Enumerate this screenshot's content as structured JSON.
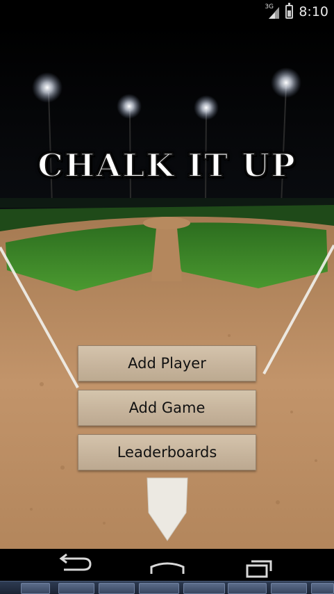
{
  "status_bar": {
    "network_label": "3G",
    "time": "8:10"
  },
  "app": {
    "title": "CHALK IT UP"
  },
  "menu": {
    "buttons": [
      {
        "label": "Add Player"
      },
      {
        "label": "Add Game"
      },
      {
        "label": "Leaderboards"
      }
    ]
  },
  "nav_bar": {
    "icons": [
      "back-icon",
      "home-icon",
      "recents-icon"
    ]
  },
  "colors": {
    "grass": "#3f8a2a",
    "dirt": "#b98a5e",
    "button_bg": "#cdbda4"
  }
}
